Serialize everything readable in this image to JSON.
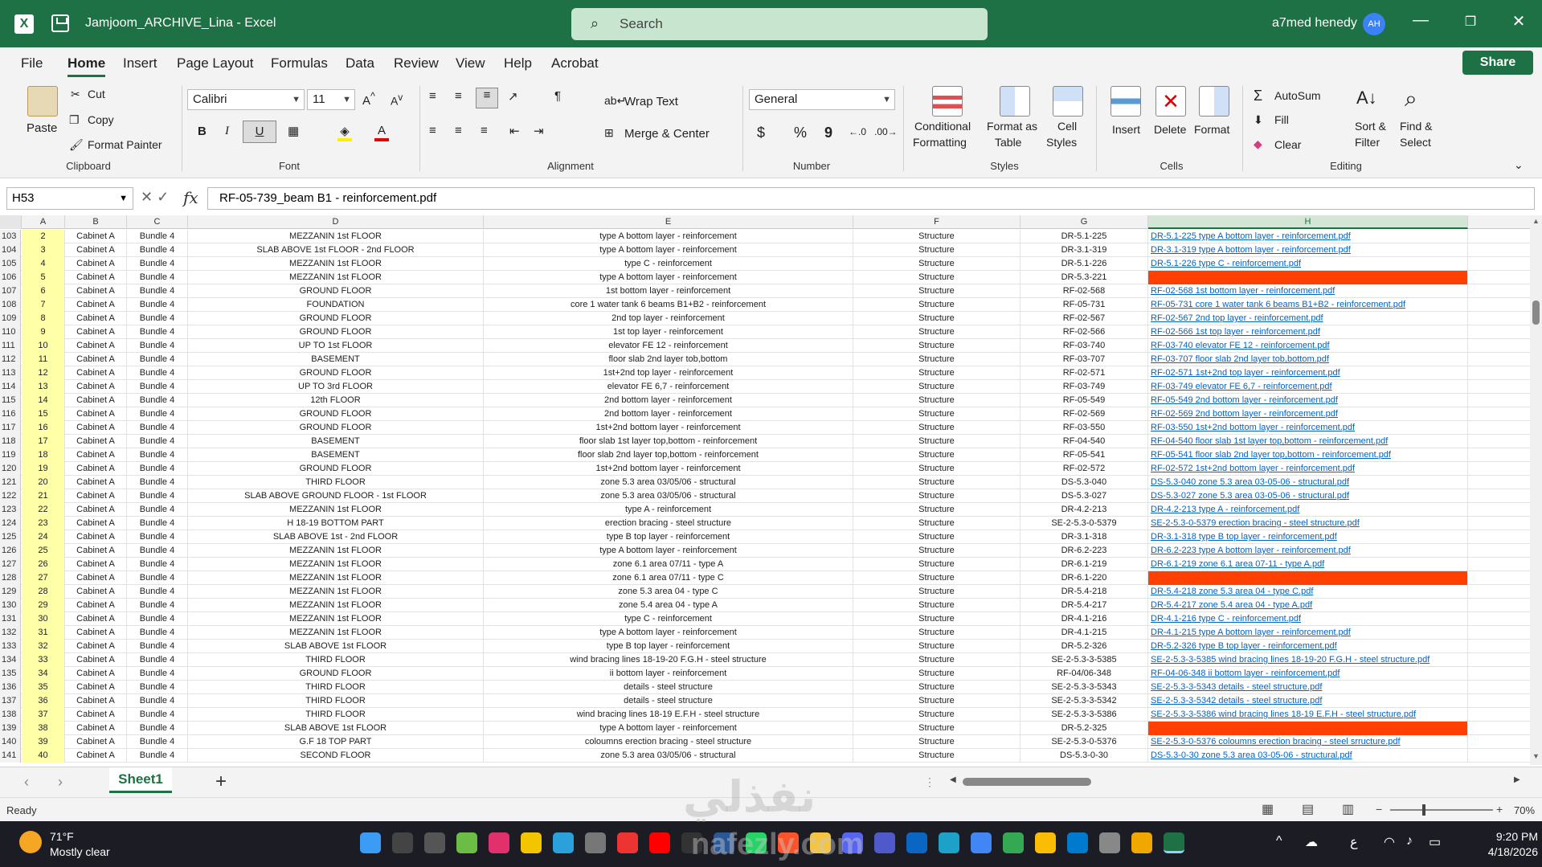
{
  "titlebar": {
    "doc_title": "Jamjoom_ARCHIVE_Lina  -  Excel",
    "search_placeholder": "Search",
    "user_name": "a7med henedy",
    "avatar_initials": "AH"
  },
  "menu": [
    "File",
    "Home",
    "Insert",
    "Page Layout",
    "Formulas",
    "Data",
    "Review",
    "View",
    "Help",
    "Acrobat"
  ],
  "share_label": "Share",
  "ribbon": {
    "clipboard": {
      "paste": "Paste",
      "cut": "Cut",
      "copy": "Copy",
      "format_painter": "Format Painter",
      "group": "Clipboard"
    },
    "font": {
      "family": "Calibri",
      "size": "11",
      "group": "Font",
      "bold": "B",
      "italic": "I",
      "underline": "U"
    },
    "alignment": {
      "wrap": "Wrap Text",
      "merge": "Merge & Center",
      "group": "Alignment"
    },
    "number": {
      "format": "General",
      "group": "Number",
      "currency": "$",
      "percent": "%",
      "comma": "9"
    },
    "styles": {
      "conditional": "Conditional",
      "conditional2": "Formatting",
      "format_as": "Format as",
      "format_as2": "Table",
      "cell": "Cell",
      "cell2": "Styles",
      "group": "Styles"
    },
    "cells": {
      "insert": "Insert",
      "delete": "Delete",
      "format": "Format",
      "group": "Cells"
    },
    "editing": {
      "autosum": "AutoSum",
      "fill": "Fill",
      "clear": "Clear",
      "sort": "Sort &",
      "sort2": "Filter",
      "find": "Find &",
      "find2": "Select",
      "group": "Editing"
    }
  },
  "formula_bar": {
    "name_box": "H53",
    "formula": "RF-05-739_beam B1 - reinforcement.pdf",
    "fx": "fx"
  },
  "columns": [
    "A",
    "B",
    "C",
    "D",
    "E",
    "F",
    "G",
    "H"
  ],
  "rows": [
    {
      "r": "103",
      "a": "2",
      "b": "Cabinet A",
      "c": "Bundle 4",
      "d": "MEZZANIN 1st FLOOR",
      "e": "type A bottom layer - reinforcement",
      "f": "Structure",
      "g": "DR-5.1-225",
      "h": "DR-5.1-225  type A bottom layer - reinforcement.pdf"
    },
    {
      "r": "104",
      "a": "3",
      "b": "Cabinet A",
      "c": "Bundle 4",
      "d": "SLAB ABOVE 1st FLOOR - 2nd FLOOR",
      "e": "type A bottom layer - reinforcement",
      "f": "Structure",
      "g": "DR-3.1-319",
      "h": "DR-3.1-319  type A bottom layer - reinforcement.pdf"
    },
    {
      "r": "105",
      "a": "4",
      "b": "Cabinet A",
      "c": "Bundle 4",
      "d": "MEZZANIN 1st FLOOR",
      "e": "type C - reinforcement",
      "f": "Structure",
      "g": "DR-5.1-226",
      "h": "DR-5.1-226  type C - reinforcement.pdf"
    },
    {
      "r": "106",
      "a": "5",
      "b": "Cabinet A",
      "c": "Bundle 4",
      "d": "MEZZANIN 1st FLOOR",
      "e": "type A bottom layer - reinforcement",
      "f": "Structure",
      "g": "DR-5.3-221",
      "h": "",
      "red": true
    },
    {
      "r": "107",
      "a": "6",
      "b": "Cabinet A",
      "c": "Bundle 4",
      "d": "GROUND FLOOR",
      "e": "1st bottom layer - reinforcement",
      "f": "Structure",
      "g": "RF-02-568",
      "h": "RF-02-568  1st bottom layer - reinforcement.pdf"
    },
    {
      "r": "108",
      "a": "7",
      "b": "Cabinet A",
      "c": "Bundle 4",
      "d": "FOUNDATION",
      "e": "core 1 water tank 6 beams B1+B2 -  reinforcement",
      "f": "Structure",
      "g": "RF-05-731",
      "h": "RF-05-731  core 1 water tank 6 beams B1+B2 - reinforcement.pdf"
    },
    {
      "r": "109",
      "a": "8",
      "b": "Cabinet A",
      "c": "Bundle 4",
      "d": "GROUND FLOOR",
      "e": "2nd top layer - reinforcement",
      "f": "Structure",
      "g": "RF-02-567",
      "h": "RF-02-567  2nd top layer - reinforcement.pdf"
    },
    {
      "r": "110",
      "a": "9",
      "b": "Cabinet A",
      "c": "Bundle 4",
      "d": "GROUND FLOOR",
      "e": "1st top layer - reinforcement",
      "f": "Structure",
      "g": "RF-02-566",
      "h": "RF-02-566  1st top layer - reinforcement.pdf"
    },
    {
      "r": "111",
      "a": "10",
      "b": "Cabinet A",
      "c": "Bundle 4",
      "d": "UP TO 1st FLOOR",
      "e": "elevator FE 12 - reinforcement",
      "f": "Structure",
      "g": "RF-03-740",
      "h": "RF-03-740  elevator FE 12 - reinforcement.pdf"
    },
    {
      "r": "112",
      "a": "11",
      "b": "Cabinet A",
      "c": "Bundle 4",
      "d": "BASEMENT",
      "e": "floor slab 2nd layer tob,bottom",
      "f": "Structure",
      "g": "RF-03-707",
      "h": "RF-03-707  floor slab 2nd layer tob,bottom.pdf"
    },
    {
      "r": "113",
      "a": "12",
      "b": "Cabinet A",
      "c": "Bundle 4",
      "d": "GROUND FLOOR",
      "e": "1st+2nd top layer - reinforcement",
      "f": "Structure",
      "g": "RF-02-571",
      "h": "RF-02-571  1st+2nd top layer - reinforcement.pdf"
    },
    {
      "r": "114",
      "a": "13",
      "b": "Cabinet A",
      "c": "Bundle 4",
      "d": "UP TO 3rd FLOOR",
      "e": "elevator FE 6,7 - reinforcement",
      "f": "Structure",
      "g": "RF-03-749",
      "h": "RF-03-749  elevator FE 6,7 - reinforcement.pdf"
    },
    {
      "r": "115",
      "a": "14",
      "b": "Cabinet A",
      "c": "Bundle 4",
      "d": "12th FLOOR",
      "e": "2nd bottom layer - reinforcement",
      "f": "Structure",
      "g": "RF-05-549",
      "h": "RF-05-549  2nd bottom layer - reinforcement.pdf"
    },
    {
      "r": "116",
      "a": "15",
      "b": "Cabinet A",
      "c": "Bundle 4",
      "d": "GROUND FLOOR",
      "e": "2nd bottom layer - reinforcement",
      "f": "Structure",
      "g": "RF-02-569",
      "h": "RF-02-569  2nd bottom layer - reinforcement.pdf"
    },
    {
      "r": "117",
      "a": "16",
      "b": "Cabinet A",
      "c": "Bundle 4",
      "d": "GROUND FLOOR",
      "e": "1st+2nd bottom layer - reinforcement",
      "f": "Structure",
      "g": "RF-03-550",
      "h": "RF-03-550  1st+2nd bottom layer - reinforcement.pdf"
    },
    {
      "r": "118",
      "a": "17",
      "b": "Cabinet A",
      "c": "Bundle 4",
      "d": "BASEMENT",
      "e": "floor slab 1st layer top,bottom - reinforcement",
      "f": "Structure",
      "g": "RF-04-540",
      "h": "RF-04-540  floor slab 1st layer top,bottom - reinforcement.pdf"
    },
    {
      "r": "119",
      "a": "18",
      "b": "Cabinet A",
      "c": "Bundle 4",
      "d": "BASEMENT",
      "e": "floor slab 2nd layer top,bottom - reinforcement",
      "f": "Structure",
      "g": "RF-05-541",
      "h": "RF-05-541  floor slab 2nd layer top,bottom - reinforcement.pdf"
    },
    {
      "r": "120",
      "a": "19",
      "b": "Cabinet A",
      "c": "Bundle 4",
      "d": "GROUND FLOOR",
      "e": "1st+2nd bottom layer - reinforcement",
      "f": "Structure",
      "g": "RF-02-572",
      "h": "RF-02-572  1st+2nd bottom layer - reinforcement.pdf"
    },
    {
      "r": "121",
      "a": "20",
      "b": "Cabinet A",
      "c": "Bundle 4",
      "d": "THIRD FLOOR",
      "e": "zone 5.3 area 03/05/06 - structural",
      "f": "Structure",
      "g": "DS-5.3-040",
      "h": "DS-5.3-040  zone 5.3 area 03-05-06 - structural.pdf"
    },
    {
      "r": "122",
      "a": "21",
      "b": "Cabinet A",
      "c": "Bundle 4",
      "d": "SLAB ABOVE GROUND FLOOR - 1st FLOOR",
      "e": "zone 5.3 area 03/05/06 - structural",
      "f": "Structure",
      "g": "DS-5.3-027",
      "h": "DS-5.3-027  zone 5.3 area 03-05-06 - structural.pdf"
    },
    {
      "r": "123",
      "a": "22",
      "b": "Cabinet A",
      "c": "Bundle 4",
      "d": "MEZZANIN 1st FLOOR",
      "e": "type A - reinforcement",
      "f": "Structure",
      "g": "DR-4.2-213",
      "h": "DR-4.2-213  type A - reinforcement.pdf"
    },
    {
      "r": "124",
      "a": "23",
      "b": "Cabinet A",
      "c": "Bundle 4",
      "d": "H 18-19 BOTTOM PART",
      "e": "erection bracing - steel structure",
      "f": "Structure",
      "g": "SE-2-5.3-0-5379",
      "h": "SE-2-5.3-0-5379  erection bracing - steel structure.pdf"
    },
    {
      "r": "125",
      "a": "24",
      "b": "Cabinet A",
      "c": "Bundle 4",
      "d": "SLAB ABOVE 1st - 2nd FLOOR",
      "e": "type B top layer - reinforcement",
      "f": "Structure",
      "g": "DR-3.1-318",
      "h": "DR-3.1-318  type B top layer - reinforcement.pdf"
    },
    {
      "r": "126",
      "a": "25",
      "b": "Cabinet A",
      "c": "Bundle 4",
      "d": "MEZZANIN 1st FLOOR",
      "e": "type A bottom layer - reinforcement",
      "f": "Structure",
      "g": "DR-6.2-223",
      "h": "DR-6.2-223  type A bottom layer - reinforcement.pdf"
    },
    {
      "r": "127",
      "a": "26",
      "b": "Cabinet A",
      "c": "Bundle 4",
      "d": "MEZZANIN 1st FLOOR",
      "e": "zone 6.1 area 07/11 - type A",
      "f": "Structure",
      "g": "DR-6.1-219",
      "h": "DR-6.1-219  zone 6.1 area 07-11 - type A.pdf"
    },
    {
      "r": "128",
      "a": "27",
      "b": "Cabinet A",
      "c": "Bundle 4",
      "d": "MEZZANIN 1st FLOOR",
      "e": "zone 6.1 area 07/11 - type C",
      "f": "Structure",
      "g": "DR-6.1-220",
      "h": "",
      "red": true
    },
    {
      "r": "129",
      "a": "28",
      "b": "Cabinet A",
      "c": "Bundle 4",
      "d": "MEZZANIN 1st FLOOR",
      "e": "zone 5.3 area 04 - type C",
      "f": "Structure",
      "g": "DR-5.4-218",
      "h": "DR-5.4-218  zone 5.3 area 04 - type C.pdf"
    },
    {
      "r": "130",
      "a": "29",
      "b": "Cabinet A",
      "c": "Bundle 4",
      "d": "MEZZANIN 1st FLOOR",
      "e": "zone 5.4 area 04 - type A",
      "f": "Structure",
      "g": "DR-5.4-217",
      "h": "DR-5.4-217  zone 5.4 area 04 - type A.pdf"
    },
    {
      "r": "131",
      "a": "30",
      "b": "Cabinet A",
      "c": "Bundle 4",
      "d": "MEZZANIN 1st FLOOR",
      "e": "type C - reinforcement",
      "f": "Structure",
      "g": "DR-4.1-216",
      "h": "DR-4.1-216  type C - reinforcement.pdf"
    },
    {
      "r": "132",
      "a": "31",
      "b": "Cabinet A",
      "c": "Bundle 4",
      "d": "MEZZANIN 1st FLOOR",
      "e": "type A bottom layer - reinforcement",
      "f": "Structure",
      "g": "DR-4.1-215",
      "h": "DR-4.1-215  type A bottom layer - reinforcement.pdf"
    },
    {
      "r": "133",
      "a": "32",
      "b": "Cabinet A",
      "c": "Bundle 4",
      "d": "SLAB ABOVE 1st FLOOR",
      "e": "type B top layer - reinforcement",
      "f": "Structure",
      "g": "DR-5.2-326",
      "h": "DR-5.2-326  type B top layer - reinforcement.pdf"
    },
    {
      "r": "134",
      "a": "33",
      "b": "Cabinet A",
      "c": "Bundle 4",
      "d": "THIRD FLOOR",
      "e": "wind bracing lines 18-19-20 F.G.H - steel structure",
      "f": "Structure",
      "g": "SE-2-5.3-3-5385",
      "h": "SE-2-5.3-3-5385  wind bracing lines 18-19-20 F.G.H - steel structure.pdf"
    },
    {
      "r": "135",
      "a": "34",
      "b": "Cabinet A",
      "c": "Bundle 4",
      "d": "GROUND FLOOR",
      "e": "ii bottom layer - reinforcement",
      "f": "Structure",
      "g": "RF-04/06-348",
      "h": "RF-04-06-348  ii bottom layer - reinforcement.pdf"
    },
    {
      "r": "136",
      "a": "35",
      "b": "Cabinet A",
      "c": "Bundle 4",
      "d": "THIRD FLOOR",
      "e": "details - steel structure",
      "f": "Structure",
      "g": "SE-2-5.3-3-5343",
      "h": "SE-2-5.3-3-5343  details - steel structure.pdf"
    },
    {
      "r": "137",
      "a": "36",
      "b": "Cabinet A",
      "c": "Bundle 4",
      "d": "THIRD FLOOR",
      "e": "details - steel structure",
      "f": "Structure",
      "g": "SE-2-5.3-3-5342",
      "h": "SE-2-5.3-3-5342  details - steel structure.pdf"
    },
    {
      "r": "138",
      "a": "37",
      "b": "Cabinet A",
      "c": "Bundle 4",
      "d": "THIRD FLOOR",
      "e": "wind bracing lines 18-19 E.F.H - steel structure",
      "f": "Structure",
      "g": "SE-2-5.3-3-5386",
      "h": "SE-2-5.3-3-5386  wind bracing lines 18-19 E.F.H - steel structure.pdf"
    },
    {
      "r": "139",
      "a": "38",
      "b": "Cabinet A",
      "c": "Bundle 4",
      "d": "SLAB ABOVE 1st FLOOR",
      "e": "type A bottom layer - reinforcement",
      "f": "Structure",
      "g": "DR-5.2-325",
      "h": "",
      "red": true
    },
    {
      "r": "140",
      "a": "39",
      "b": "Cabinet A",
      "c": "Bundle 4",
      "d": "G.F 18 TOP PART",
      "e": "coloumns erection bracing - steel structure",
      "f": "Structure",
      "g": "SE-2-5.3-0-5376",
      "h": "SE-2-5.3-0-5376  coloumns erection bracing - steel srructure.pdf"
    },
    {
      "r": "141",
      "a": "40",
      "b": "Cabinet A",
      "c": "Bundle 4",
      "d": "SECOND FLOOR",
      "e": "zone 5.3 area 03/05/06 - structural",
      "f": "Structure",
      "g": "DS-5.3-0-30",
      "h": "DS-5.3-0-30  zone 5.3 area 03-05-06 - structural.pdf"
    }
  ],
  "sheet_tab": "Sheet1",
  "status": {
    "ready": "Ready",
    "zoom": "70%"
  },
  "taskbar": {
    "temp": "71°F",
    "weather": "Mostly clear",
    "time": "9:20 PM",
    "date": "4/18/2026"
  },
  "watermark": {
    "arabic": "نفذلي",
    "latin": "nafezly.com"
  },
  "colors": {
    "accent": "#1e7145",
    "missing": "#ff4000",
    "link": "#0563c1",
    "col_a": "#ffffa8"
  }
}
